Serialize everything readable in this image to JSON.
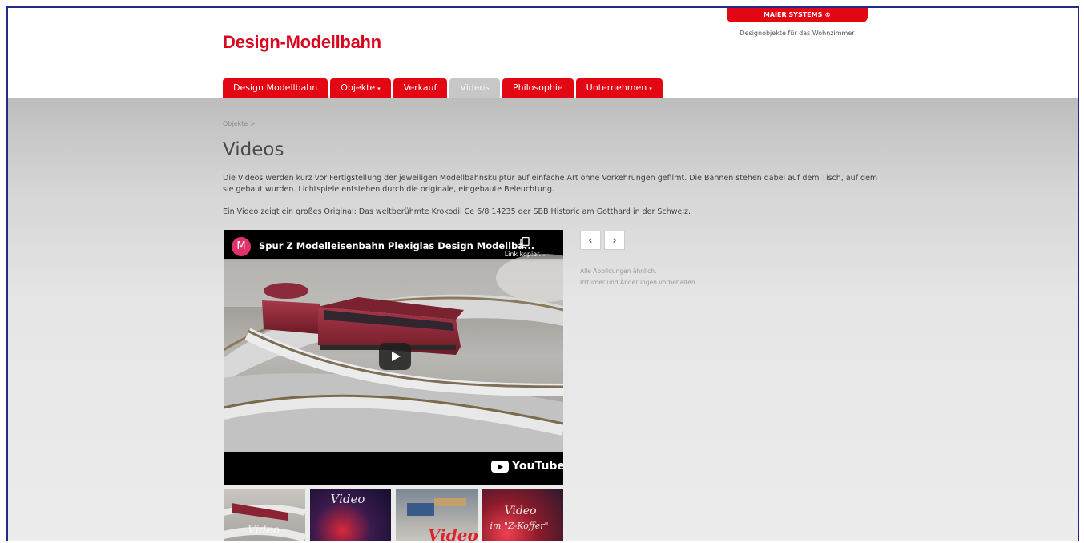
{
  "header": {
    "site_title": "Design-Modellbahn",
    "brand_badge": "MAIER SYSTEMS ®",
    "tagline": "Designobjekte für das Wohnzimmer"
  },
  "nav": {
    "tabs": [
      {
        "label": "Design Modellbahn",
        "dropdown": false,
        "active": false
      },
      {
        "label": "Objekte",
        "dropdown": true,
        "active": false
      },
      {
        "label": "Verkauf",
        "dropdown": false,
        "active": false
      },
      {
        "label": "Videos",
        "dropdown": false,
        "active": true
      },
      {
        "label": "Philosophie",
        "dropdown": false,
        "active": false
      },
      {
        "label": "Unternehmen",
        "dropdown": true,
        "active": false
      }
    ],
    "caret": "▾"
  },
  "breadcrumb": "Objekte >",
  "page": {
    "title": "Videos",
    "intro": "Die Videos werden kurz vor Fertigstellung der jeweiligen Modellbahnskulptur auf einfache Art ohne Vorkehrungen gefilmt. Die Bahnen stehen dabei auf dem Tisch, auf dem sie gebaut wurden. Lichtspiele entstehen durch die originale, eingebaute Beleuchtung.",
    "intro2": "Ein Video zeigt ein großes Original: Das weltberühmte Krokodil Ce 6/8 14235 der SBB Historic am Gotthard in der Schweiz."
  },
  "player": {
    "channel_initial": "M",
    "video_title": "Spur Z Modelleisenbahn Plexiglas Design Modellba...",
    "copy_link_label": "Link kopier...",
    "youtube_label": "YouTube"
  },
  "thumbnails": [
    {
      "label": "Video"
    },
    {
      "label": "Video"
    },
    {
      "label": "Video"
    },
    {
      "label": "Video",
      "sublabel": "im \"Z-Koffer\""
    }
  ],
  "pager": {
    "prev": "‹",
    "next": "›"
  },
  "disclaimer": {
    "line1": "Alle Abbildungen ähnlich.",
    "line2": "Irrtümer und Änderungen vorbehalten."
  },
  "colors": {
    "brand_red": "#e30613",
    "title_red": "#d9061f",
    "active_tab": "#c7c7c7"
  }
}
